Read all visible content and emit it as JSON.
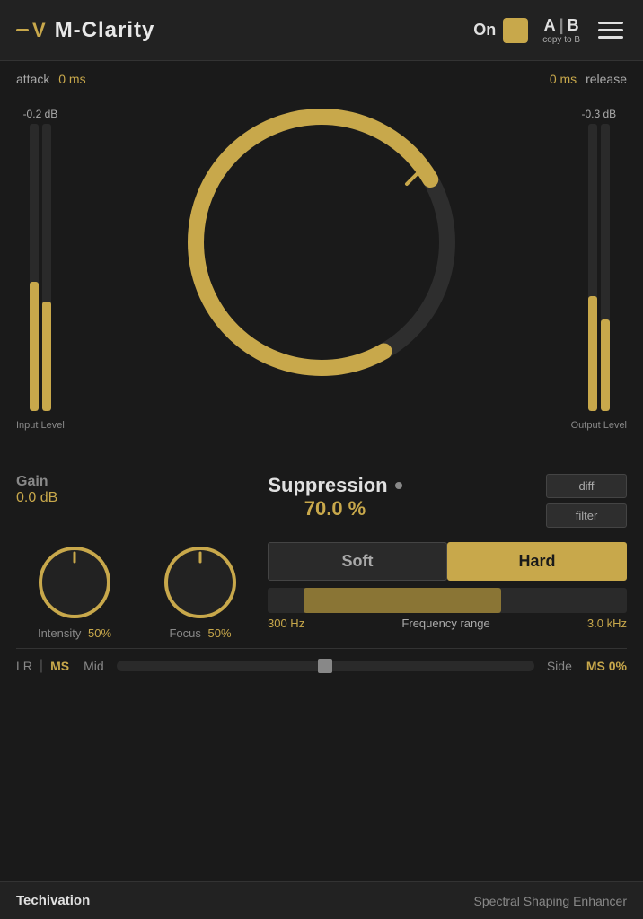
{
  "header": {
    "logo_dash": "—",
    "logo_v": "V",
    "title": "M-Clarity",
    "on_label": "On",
    "ab_a": "A",
    "ab_b": "B",
    "ab_sep": "|",
    "ab_copy": "copy to B",
    "menu_icon": "menu"
  },
  "controls": {
    "attack_label": "attack",
    "attack_value": "0 ms",
    "release_value": "0 ms",
    "release_label": "release",
    "input_db": "-0.2 dB",
    "output_db": "-0.3 dB",
    "input_label": "Input Level",
    "output_label": "Output Level",
    "gain_label": "Gain",
    "gain_value": "0.0 dB",
    "suppression_label": "Suppression",
    "suppression_value": "70.0 %",
    "diff_label": "diff",
    "filter_label": "filter"
  },
  "bottom": {
    "intensity_label": "Intensity",
    "intensity_value": "50%",
    "focus_label": "Focus",
    "focus_value": "50%",
    "soft_label": "Soft",
    "hard_label": "Hard",
    "freq_low": "300 Hz",
    "freq_range_label": "Frequency range",
    "freq_high": "3.0 kHz"
  },
  "ms_row": {
    "lr_label": "LR",
    "ms_label": "MS",
    "mid_label": "Mid",
    "side_label": "Side",
    "ms_value": "MS 0%"
  },
  "footer": {
    "brand": "Techivation",
    "desc": "Spectral Shaping Enhancer"
  }
}
